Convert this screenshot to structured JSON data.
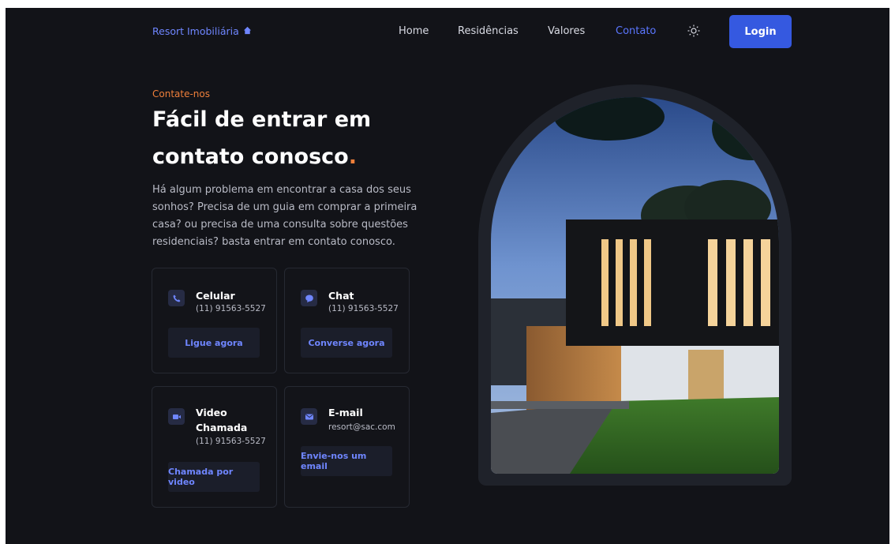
{
  "nav": {
    "logo": "Resort Imobiliária",
    "links": [
      "Home",
      "Residências",
      "Valores",
      "Contato"
    ],
    "active": "Contato",
    "login": "Login"
  },
  "hero": {
    "eyebrow": "Contate-nos",
    "title_line1": "Fácil de entrar em",
    "title_line2": "contato conosco",
    "title_dot": ".",
    "description": "Há algum problema em encontrar a casa dos seus sonhos? Precisa de um guia em comprar a primeira casa? ou precisa de uma consulta sobre questões residenciais? basta entrar em contato conosco."
  },
  "cards": [
    {
      "title": "Celular",
      "value": "(11) 91563-5527",
      "button": "Ligue agora",
      "icon": "phone-icon"
    },
    {
      "title": "Chat",
      "value": "(11) 91563-5527",
      "button": "Converse agora",
      "icon": "chat-icon"
    },
    {
      "title_line1": "Video",
      "title_line2": "Chamada",
      "value": "(11) 91563-5527",
      "button": "Chamada por video",
      "icon": "video-icon"
    },
    {
      "title": "E-mail",
      "value": "resort@sac.com",
      "button": "Envie-nos um email",
      "icon": "mail-icon"
    }
  ],
  "colors": {
    "background": "#121318",
    "accent_blue": "#3559e0",
    "link_blue": "#6f86ff",
    "accent_orange": "#ef7f3a"
  }
}
